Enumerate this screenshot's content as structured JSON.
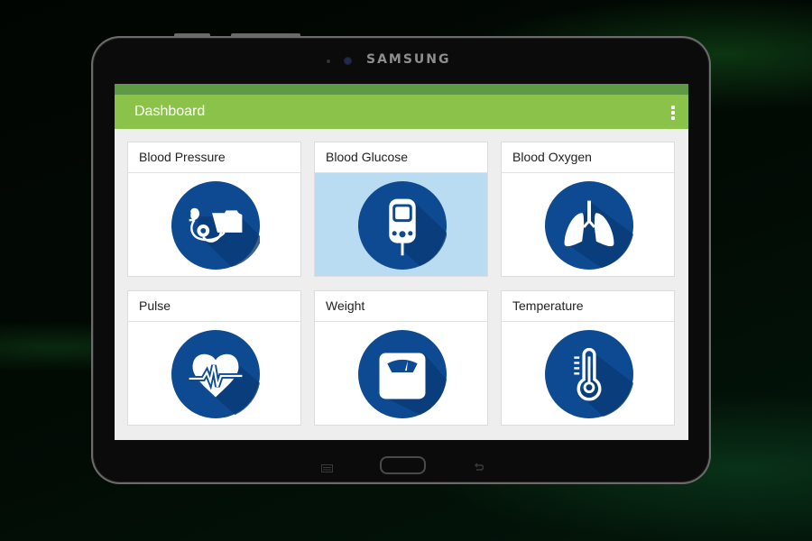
{
  "device": {
    "brand": "SAMSUNG",
    "nav_buttons": [
      "menu",
      "home",
      "back"
    ]
  },
  "app": {
    "title": "Dashboard",
    "overflow_icon": "more-vert-icon",
    "colors": {
      "status_bar": "#5e9a45",
      "app_bar": "#8bc34a",
      "icon_circle": "#0d4a92",
      "selected_card": "#b9dcf2"
    }
  },
  "cards": [
    {
      "label": "Blood Pressure",
      "icon": "blood-pressure-cuff-icon",
      "selected": false
    },
    {
      "label": "Blood Glucose",
      "icon": "glucose-meter-icon",
      "selected": true
    },
    {
      "label": "Blood Oxygen",
      "icon": "lungs-icon",
      "selected": false
    },
    {
      "label": "Pulse",
      "icon": "heart-pulse-icon",
      "selected": false
    },
    {
      "label": "Weight",
      "icon": "scale-icon",
      "selected": false
    },
    {
      "label": "Temperature",
      "icon": "thermometer-icon",
      "selected": false
    }
  ]
}
